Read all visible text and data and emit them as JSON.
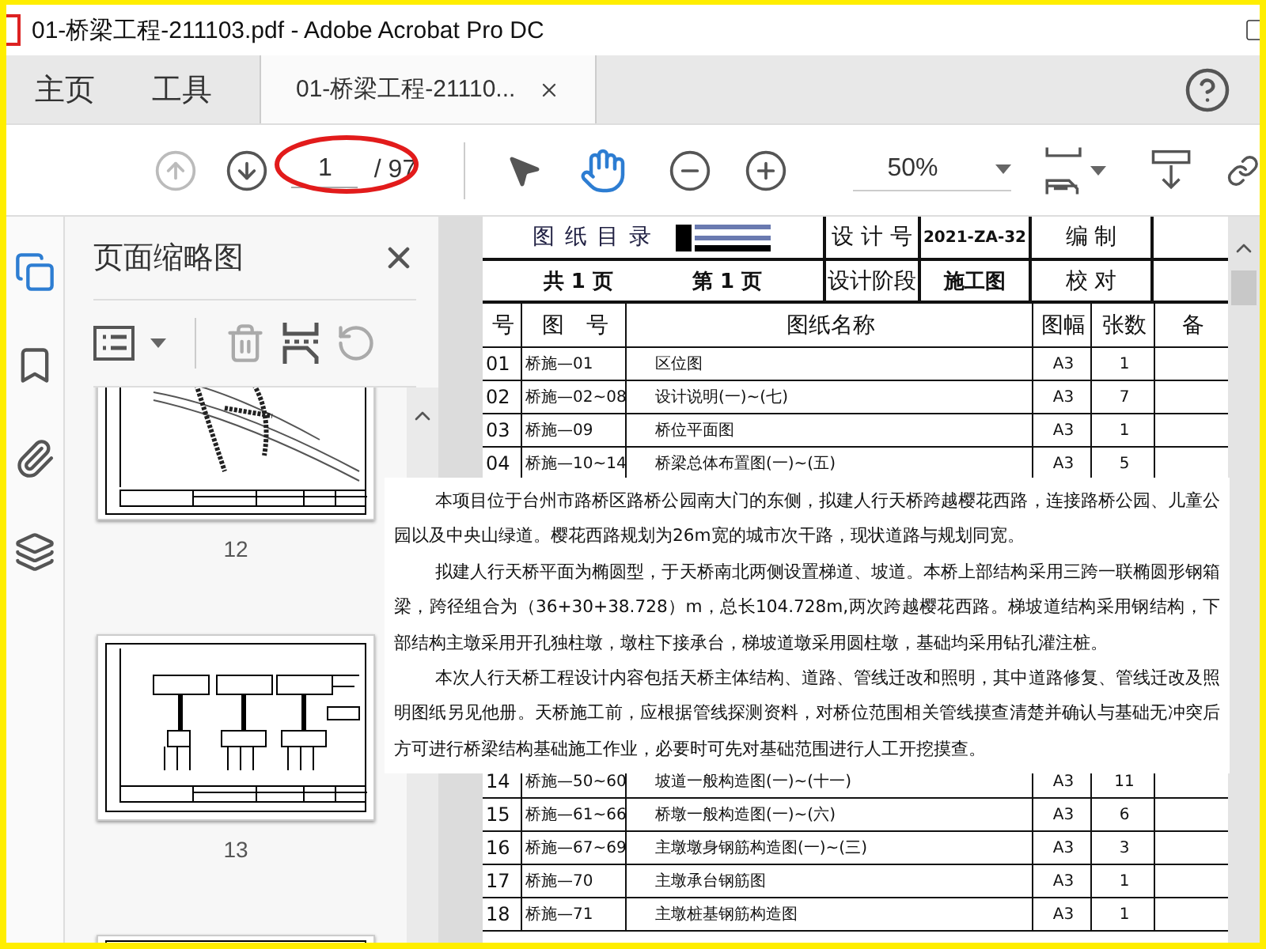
{
  "window": {
    "title": "01-桥梁工程-211103.pdf - Adobe Acrobat Pro DC"
  },
  "tabs": [
    {
      "label": "主页",
      "selected": false
    },
    {
      "label": "工具",
      "selected": false
    },
    {
      "label": "01-桥梁工程-21110...",
      "selected": true
    }
  ],
  "toolbar": {
    "prev_page": {
      "disabled": true
    },
    "next_page": {
      "disabled": false
    },
    "page_input": "1",
    "page_total": "/ 97",
    "annotated": true,
    "tools": [
      {
        "kind": "select",
        "selected": false
      },
      {
        "kind": "hand",
        "selected": true
      }
    ],
    "zoom": "50%"
  },
  "rail": [
    {
      "kind": "pages",
      "selected": true
    },
    {
      "kind": "bookmarks",
      "selected": false
    },
    {
      "kind": "attachments",
      "selected": false
    },
    {
      "kind": "layers",
      "selected": false
    }
  ],
  "panel": {
    "title": "页面缩略图",
    "thumbnails": [
      {
        "label": "12",
        "kind": "plan"
      },
      {
        "label": "13",
        "kind": "piers"
      }
    ]
  },
  "document": {
    "title": "图 纸 目 录",
    "design_no_label": "设 计 号",
    "design_no": "2021-ZA-32",
    "compiled_label": "编 制",
    "pages_total": "共 1 页",
    "page_current": "第 1 页",
    "stage_label": "设计阶段",
    "stage": "施工图",
    "check_label": "校 对",
    "columns": [
      "号",
      "图　号",
      "图纸名称",
      "图幅",
      "张数",
      "备"
    ],
    "rows": [
      [
        "01",
        "桥施—01",
        "区位图",
        "A3",
        "1"
      ],
      [
        "02",
        "桥施—02~08",
        "设计说明(一)~(七)",
        "A3",
        "7"
      ],
      [
        "03",
        "桥施—09",
        "桥位平面图",
        "A3",
        "1"
      ],
      [
        "04",
        "桥施—10~14",
        "桥梁总体布置图(一)~(五)",
        "A3",
        "5"
      ]
    ],
    "rows_after": [
      [
        "14",
        "桥施—50~60",
        "坡道一般构造图(一)~(十一)",
        "A3",
        "11"
      ],
      [
        "15",
        "桥施—61~66",
        "桥墩一般构造图(一)~(六)",
        "A3",
        "6"
      ],
      [
        "16",
        "桥施—67~69",
        "主墩墩身钢筋构造图(一)~(三)",
        "A3",
        "3"
      ],
      [
        "17",
        "桥施—70",
        "主墩承台钢筋图",
        "A3",
        "1"
      ],
      [
        "18",
        "桥施—71",
        "主墩桩基钢筋构造图",
        "A3",
        "1"
      ]
    ],
    "note": [
      "本项目位于台州市路桥区路桥公园南大门的东侧，拟建人行天桥跨越樱花西路，连接路桥公园、儿童公园以及中央山绿道。樱花西路规划为26m宽的城市次干路，现状道路与规划同宽。",
      "拟建人行天桥平面为椭圆型，于天桥南北两侧设置梯道、坡道。本桥上部结构采用三跨一联椭圆形钢箱梁，跨径组合为（36+30+38.728）m，总长104.728m,两次跨越樱花西路。梯坡道结构采用钢结构，下部结构主墩采用开孔独柱墩，墩柱下接承台，梯坡道墩采用圆柱墩，基础均采用钻孔灌注桩。",
      "本次人行天桥工程设计内容包括天桥主体结构、道路、管线迁改和照明，其中道路修复、管线迁改及照明图纸另见他册。天桥施工前，应根据管线探测资料，对桥位范围相关管线摸查清楚并确认与基础无冲突后方可进行桥梁结构基础施工作业，必要时可先对基础范围进行人工开挖摸查。"
    ]
  }
}
